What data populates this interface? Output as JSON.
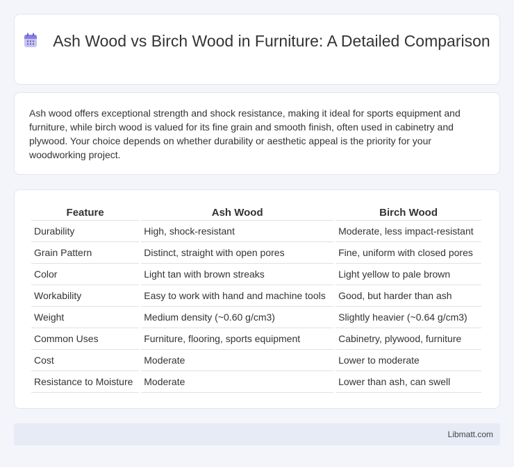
{
  "header": {
    "icon": "calendar-icon",
    "title": "Ash Wood vs Birch Wood in Furniture: A Detailed Comparison"
  },
  "intro": {
    "text": "Ash wood offers exceptional strength and shock resistance, making it ideal for sports equipment and furniture, while birch wood is valued for its fine grain and smooth finish, often used in cabinetry and plywood. Your choice depends on whether durability or aesthetic appeal is the priority for your woodworking project."
  },
  "table": {
    "headers": [
      "Feature",
      "Ash Wood",
      "Birch Wood"
    ],
    "rows": [
      [
        "Durability",
        "High, shock-resistant",
        "Moderate, less impact-resistant"
      ],
      [
        "Grain Pattern",
        "Distinct, straight with open pores",
        "Fine, uniform with closed pores"
      ],
      [
        "Color",
        "Light tan with brown streaks",
        "Light yellow to pale brown"
      ],
      [
        "Workability",
        "Easy to work with hand and machine tools",
        "Good, but harder than ash"
      ],
      [
        "Weight",
        "Medium density (~0.60 g/cm3)",
        "Slightly heavier (~0.64 g/cm3)"
      ],
      [
        "Common Uses",
        "Furniture, flooring, sports equipment",
        "Cabinetry, plywood, furniture"
      ],
      [
        "Cost",
        "Moderate",
        "Lower to moderate"
      ],
      [
        "Resistance to Moisture",
        "Moderate",
        "Lower than ash, can swell"
      ]
    ]
  },
  "footer": {
    "text": "Libmatt.com"
  }
}
